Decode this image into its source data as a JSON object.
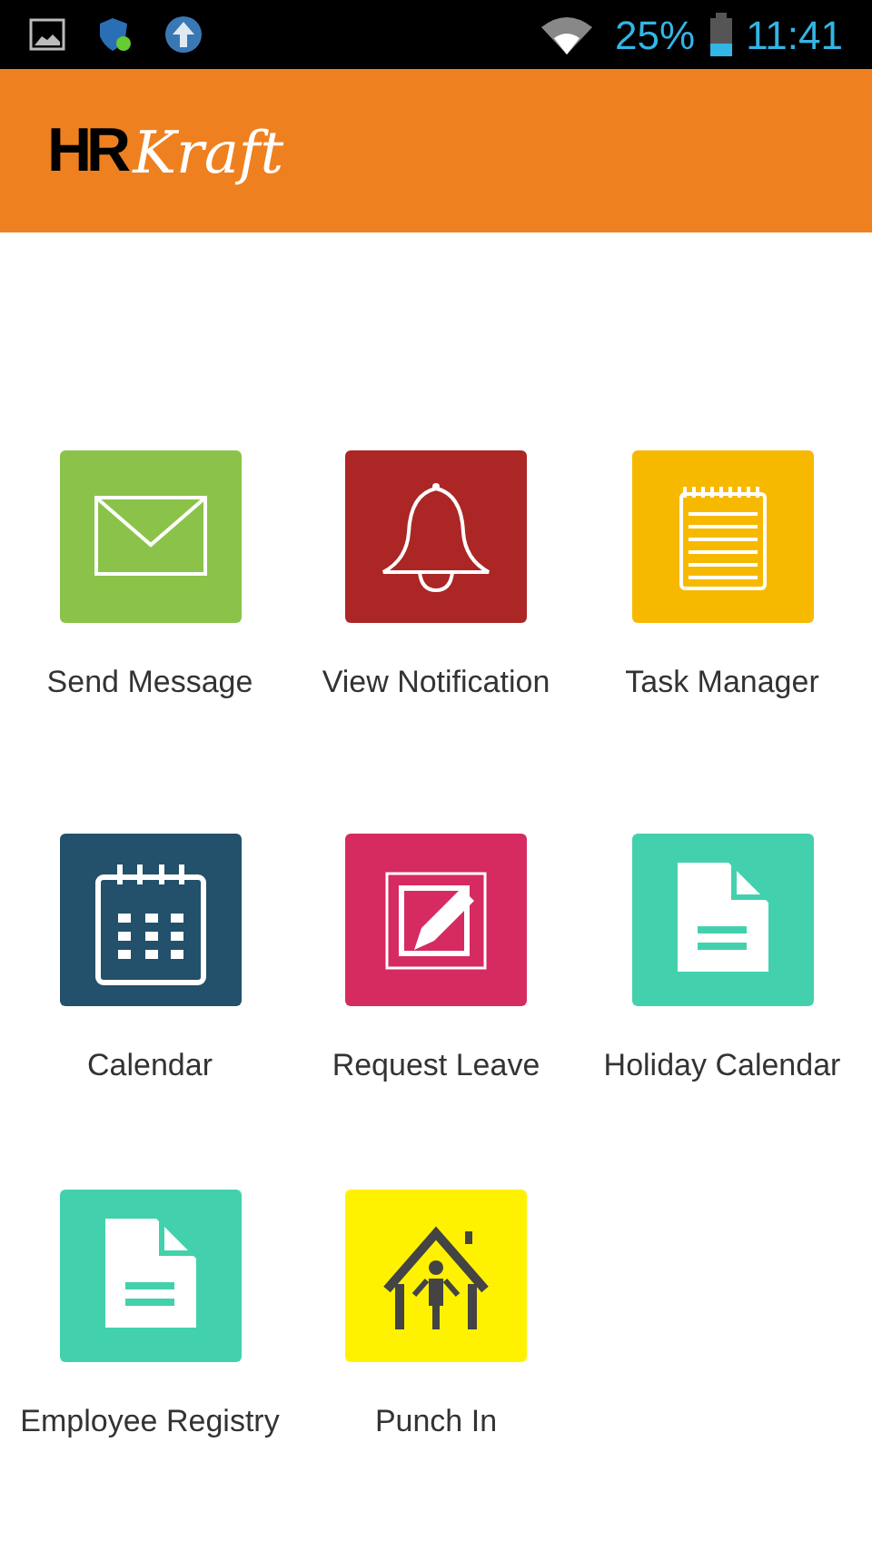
{
  "status_bar": {
    "battery": "25%",
    "time": "11:41"
  },
  "header": {
    "logo_main": "HR",
    "logo_script": "Kraft"
  },
  "menu": [
    {
      "label": "Send Message",
      "kind": "envelope",
      "color": "#8bc34a"
    },
    {
      "label": "View Notification",
      "kind": "bell",
      "color": "#ac2626"
    },
    {
      "label": "Task Manager",
      "kind": "notepad",
      "color": "#f7b900"
    },
    {
      "label": "Calendar",
      "kind": "calendar",
      "color": "#23506b"
    },
    {
      "label": "Request Leave",
      "kind": "edit",
      "color": "#d62b61"
    },
    {
      "label": "Holiday Calendar",
      "kind": "document",
      "color": "#43d1ad"
    },
    {
      "label": "Employee Registry",
      "kind": "document",
      "color": "#43d1ad"
    },
    {
      "label": "Punch In",
      "kind": "house",
      "color": "#fff200"
    }
  ]
}
